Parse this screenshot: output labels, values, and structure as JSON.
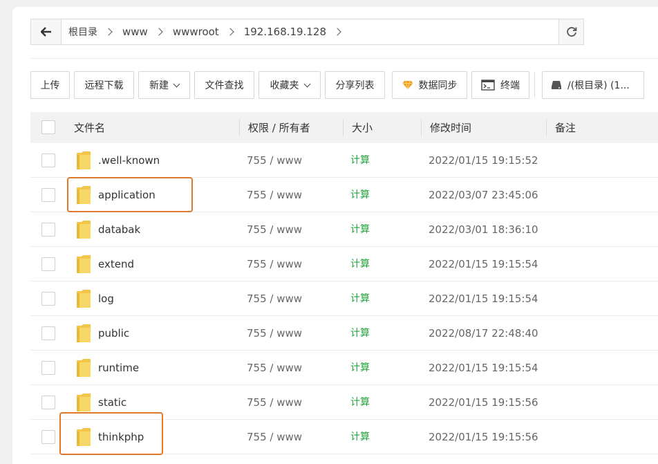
{
  "breadcrumb": {
    "items": [
      "根目录",
      "www",
      "wwwroot",
      "192.168.19.128"
    ]
  },
  "toolbar": {
    "upload": "上传",
    "remote_download": "远程下载",
    "new": "新建",
    "file_search": "文件查找",
    "favorites": "收藏夹",
    "share_list": "分享列表",
    "data_sync": "数据同步",
    "terminal": "终端",
    "disk": "/(根目录) (1..."
  },
  "table": {
    "headers": {
      "name": "文件名",
      "perm_owner": "权限 / 所有者",
      "size": "大小",
      "mtime": "修改时间",
      "note": "备注"
    },
    "rows": [
      {
        "name": ".well-known",
        "perm": "755 / www",
        "size": "计算",
        "mtime": "2022/01/15 19:15:52"
      },
      {
        "name": "application",
        "perm": "755 / www",
        "size": "计算",
        "mtime": "2022/03/07 23:45:06"
      },
      {
        "name": "databak",
        "perm": "755 / www",
        "size": "计算",
        "mtime": "2022/03/01 18:36:10"
      },
      {
        "name": "extend",
        "perm": "755 / www",
        "size": "计算",
        "mtime": "2022/01/15 19:15:54"
      },
      {
        "name": "log",
        "perm": "755 / www",
        "size": "计算",
        "mtime": "2022/01/15 19:15:54"
      },
      {
        "name": "public",
        "perm": "755 / www",
        "size": "计算",
        "mtime": "2022/08/17 22:48:40"
      },
      {
        "name": "runtime",
        "perm": "755 / www",
        "size": "计算",
        "mtime": "2022/01/15 19:15:54"
      },
      {
        "name": "static",
        "perm": "755 / www",
        "size": "计算",
        "mtime": "2022/01/15 19:15:56"
      },
      {
        "name": "thinkphp",
        "perm": "755 / www",
        "size": "计算",
        "mtime": "2022/01/15 19:15:56"
      }
    ]
  },
  "colors": {
    "highlight": "#e0782c",
    "size_link": "#20a53a",
    "folder": "#f5c542"
  }
}
